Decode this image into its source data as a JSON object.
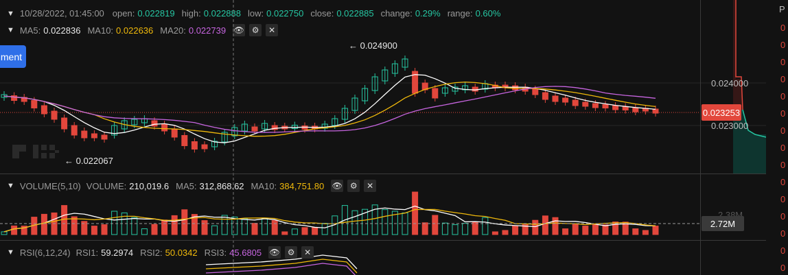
{
  "header": {
    "datetime": "10/28/2022, 01:45:00",
    "open_label": "open:",
    "open": "0.022819",
    "high_label": "high:",
    "high": "0.022888",
    "low_label": "low:",
    "low": "0.022750",
    "close_label": "close:",
    "close": "0.022885",
    "change_label": "change:",
    "change": "0.29%",
    "range_label": "range:",
    "range": "0.60%"
  },
  "ma": {
    "ma5_label": "MA5:",
    "ma5": "0.022836",
    "ma10_label": "MA10:",
    "ma10": "0.022636",
    "ma20_label": "MA20:",
    "ma20": "0.022739"
  },
  "volume": {
    "title": "VOLUME(5,10)",
    "vol_label": "VOLUME:",
    "vol": "210,019.6",
    "ma5_label": "MA5:",
    "ma5": "312,868.62",
    "ma10_label": "MA10:",
    "ma10": "384,751.80",
    "tag": "2.72M",
    "hidden_tick": "2.38M"
  },
  "rsi": {
    "title": "RSI(6,12,24)",
    "rsi1_label": "RSI1:",
    "rsi1": "59.2974",
    "rsi2_label": "RSI2:",
    "rsi2": "50.0342",
    "rsi3_label": "RSI3:",
    "rsi3": "45.6805"
  },
  "left_button": {
    "label": "ment"
  },
  "price_axis": {
    "tick_1": "0.024000",
    "tick_2": "0.023000",
    "current": "0.023253"
  },
  "annotations": {
    "high": "← 0.024900",
    "low": "← 0.022067"
  },
  "right_column": {
    "header": "P",
    "digits": [
      "0",
      "0",
      "0",
      "0",
      "0",
      "0",
      "0",
      "0",
      "0",
      "0",
      "0",
      "0",
      "0",
      "0",
      "0",
      "0"
    ]
  },
  "watermark": "OKX",
  "colors": {
    "up": "#26c6a2",
    "down": "#e2473c",
    "ma5": "#ffffff",
    "ma10": "#f0b90b",
    "ma20": "#c765e0"
  },
  "chart_data": {
    "type": "candlestick",
    "y_axis_ticks": [
      0.024,
      0.023
    ],
    "current_price": 0.023253,
    "annotated_high": 0.0249,
    "annotated_low": 0.022067
  }
}
